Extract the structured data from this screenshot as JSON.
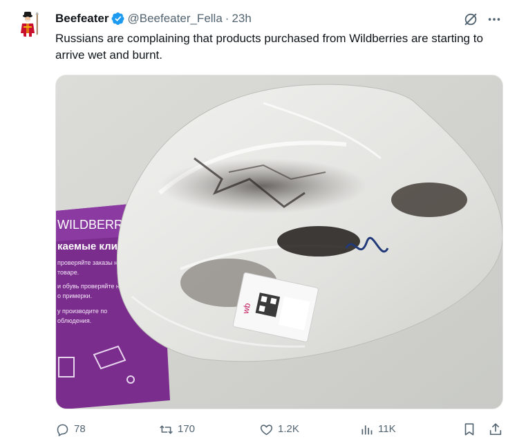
{
  "author": {
    "display_name": "Beefeater",
    "handle": "@Beefeater_Fella",
    "separator": "·",
    "time": "23h",
    "avatar": "beefeater-guard-avatar"
  },
  "tweet": {
    "text": "Russians are complaining that products purchased from Wildberries are starting to arrive wet and burnt."
  },
  "media": {
    "description_icon": "photo",
    "sign_brand": "WILDBERRIES",
    "sign_heading": "каемые клиен",
    "sign_lines": [
      "проверяйте заказы на н",
      "товаре.",
      "и обувь проверяйте н",
      "о примерки.",
      "у производите по",
      "облюдения."
    ],
    "label_text": "wb"
  },
  "actions": {
    "replies": "78",
    "reposts": "170",
    "likes": "1.2K",
    "views": "11K"
  },
  "icons": {
    "verified": "verified-badge-icon",
    "grok": "grok-icon",
    "more": "more-icon",
    "reply": "reply-icon",
    "repost": "repost-icon",
    "like": "like-icon",
    "views": "views-icon",
    "bookmark": "bookmark-icon",
    "share": "share-icon"
  },
  "colors": {
    "text_primary": "#0f1419",
    "text_secondary": "#536471",
    "verified_blue": "#1d9bf0",
    "sign_purple": "#7b2d8e"
  }
}
